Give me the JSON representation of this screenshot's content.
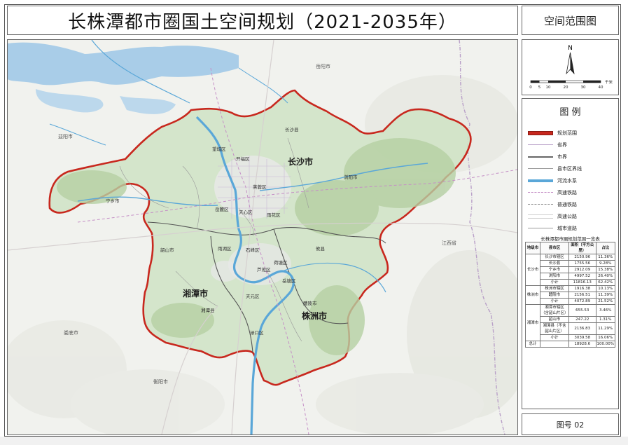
{
  "title": "长株潭都市圈国土空间规划（2021-2035年）",
  "sheet_name": "空间范围图",
  "figure_number": "图号 02",
  "north": {
    "letter": "N",
    "scale_ticks": [
      "0",
      "5",
      "10",
      "20",
      "30",
      "40"
    ],
    "scale_unit": "千米"
  },
  "legend": {
    "title": "图 例",
    "items": [
      {
        "label": "规划范围",
        "color": "#c8281e",
        "style": "boundary"
      },
      {
        "label": "省界",
        "color": "#b9a0c8",
        "style": "line"
      },
      {
        "label": "市界",
        "color": "#666666",
        "style": "thick"
      },
      {
        "label": "县市区界线",
        "color": "#9a9a9a",
        "style": "line"
      },
      {
        "label": "河流水系",
        "color": "#5aa7d8",
        "style": "river"
      },
      {
        "label": "高速铁路",
        "color": "#c58fc6",
        "style": "dashed"
      },
      {
        "label": "普通铁路",
        "color": "#8c8c8c",
        "style": "dashed"
      },
      {
        "label": "高速公路",
        "color": "#cfcfcf",
        "style": "double"
      },
      {
        "label": "城市道路",
        "color": "#9a9a9a",
        "style": "line"
      }
    ]
  },
  "area_table": {
    "caption": "长株潭都市圈规划范围一览表",
    "headers": [
      "地级市",
      "县市区",
      "面积（平方公里）",
      "占比"
    ],
    "rows": [
      {
        "city": "长沙市",
        "span": 5,
        "district": "长沙市辖区",
        "area": "2150.96",
        "pct": "11.36%"
      },
      {
        "district": "长沙县",
        "area": "1755.56",
        "pct": "9.28%"
      },
      {
        "district": "宁乡市",
        "area": "2912.09",
        "pct": "15.38%"
      },
      {
        "district": "浏阳市",
        "area": "4997.52",
        "pct": "26.40%"
      },
      {
        "district": "小计",
        "area": "11816.13",
        "pct": "62.42%"
      },
      {
        "city": "株洲市",
        "span": 3,
        "district": "株洲市辖区",
        "area": "1916.38",
        "pct": "10.13%"
      },
      {
        "district": "醴陵市",
        "area": "2156.51",
        "pct": "11.39%"
      },
      {
        "district": "小计",
        "area": "4072.89",
        "pct": "21.52%"
      },
      {
        "city": "湘潭市",
        "span": 4,
        "district": "湘潭市辖区（含韶山片区）",
        "area": "655.53",
        "pct": "3.46%"
      },
      {
        "district": "韶山市",
        "area": "247.22",
        "pct": "1.31%"
      },
      {
        "district": "湘潭县（不含韶山片区）",
        "area": "2136.83",
        "pct": "11.29%"
      },
      {
        "district": "小计",
        "area": "3039.58",
        "pct": "16.06%"
      },
      {
        "city": "总计",
        "span": 1,
        "district": "",
        "area": "18928.6",
        "pct": "100.00%"
      }
    ]
  },
  "map": {
    "city_labels": [
      "长沙市",
      "湘潭市",
      "株洲市"
    ],
    "district_labels": [
      "长沙县",
      "开福区",
      "望城区",
      "芙蓉区",
      "雨花区",
      "岳麓区",
      "天心区",
      "宁乡市",
      "浏阳市",
      "韶山市",
      "湘潭县",
      "醴陵市",
      "渌口区",
      "天元区",
      "荷塘区",
      "石峰区",
      "芦淞区",
      "雨湖区",
      "岳塘区",
      "攸县"
    ],
    "context_labels": [
      "岳阳市",
      "益阳市",
      "娄底市",
      "衡阳市",
      "江西省"
    ],
    "colors": {
      "boundary": "#c8281e",
      "inner_fill": "#cfe3c4",
      "river": "#5aa7d8",
      "lake": "#a9cde8"
    }
  }
}
